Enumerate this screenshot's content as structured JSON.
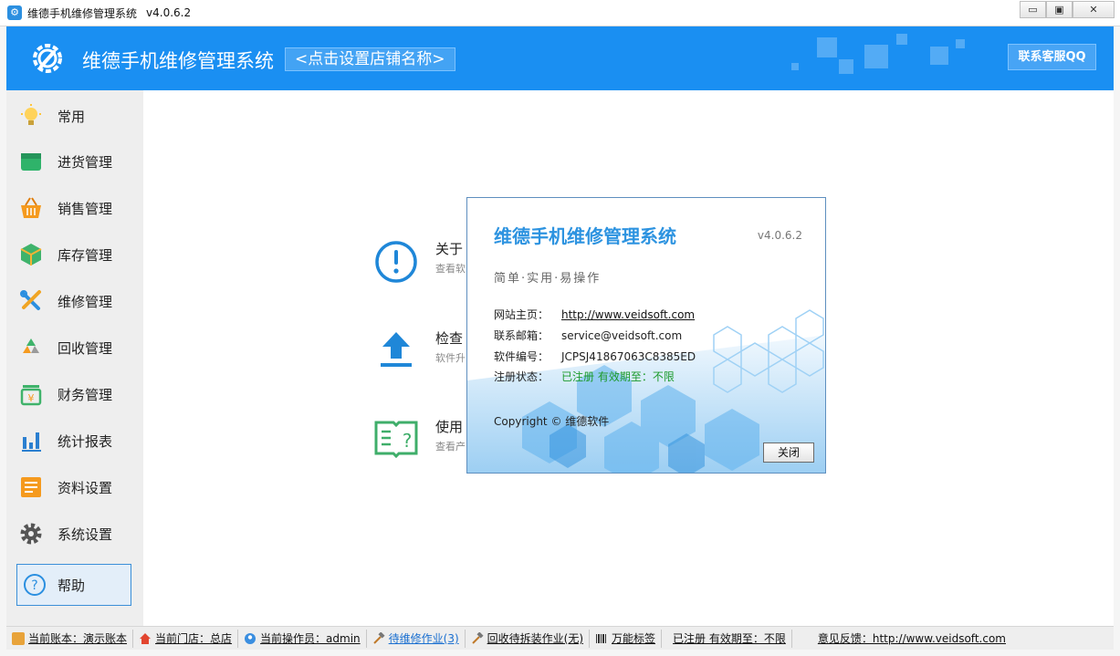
{
  "window": {
    "title": "维德手机维修管理系统",
    "version": "v4.0.6.2",
    "min_glyph": "▭",
    "max_glyph": "▣",
    "close_glyph": "✕"
  },
  "header": {
    "app_name": "维德手机维修管理系统",
    "shop_button": "<点击设置店铺名称>",
    "qq_button": "联系客服QQ",
    "accent": "#1a8ff2"
  },
  "sidebar": {
    "items": [
      {
        "label": "常用",
        "icon": "lightbulb-icon"
      },
      {
        "label": "进货管理",
        "icon": "box-icon"
      },
      {
        "label": "销售管理",
        "icon": "basket-icon"
      },
      {
        "label": "库存管理",
        "icon": "cubes-icon"
      },
      {
        "label": "维修管理",
        "icon": "wrench-icon"
      },
      {
        "label": "回收管理",
        "icon": "recycle-icon"
      },
      {
        "label": "财务管理",
        "icon": "money-icon"
      },
      {
        "label": "统计报表",
        "icon": "bar-chart-icon"
      },
      {
        "label": "资料设置",
        "icon": "document-icon"
      },
      {
        "label": "系统设置",
        "icon": "gear-icon"
      },
      {
        "label": "帮助",
        "icon": "help-icon"
      }
    ]
  },
  "main": {
    "items": [
      {
        "title": "关于",
        "subtitle": "查看软",
        "icon": "info-icon"
      },
      {
        "title": "检查",
        "subtitle": "软件升",
        "icon": "upload-icon"
      },
      {
        "title": "使用",
        "subtitle": "查看产",
        "icon": "manual-icon"
      }
    ]
  },
  "about_dialog": {
    "title": "维德手机维修管理系统",
    "version": "v4.0.6.2",
    "slogan": "简单·实用·易操作",
    "website_label": "网站主页：",
    "website_value": "http://www.veidsoft.com",
    "email_label": "联系邮箱：",
    "email_value": "service@veidsoft.com",
    "serial_label": "软件编号：",
    "serial_value": "JCPSJ41867063C8385ED",
    "status_label": "注册状态：",
    "status_value": "已注册 有效期至：不限",
    "copyright": "Copyright © 维德软件",
    "close_button": "关闭"
  },
  "statusbar": {
    "account": "当前账本：演示账本",
    "store": "当前门店：总店",
    "operator": "当前操作员：admin",
    "pending_repair": "待维修作业(3)",
    "pending_recycle": "回收待拆装作业(无)",
    "labels": "万能标签",
    "registration": "已注册 有效期至：不限",
    "feedback": "意见反馈：http://www.veidsoft.com"
  }
}
